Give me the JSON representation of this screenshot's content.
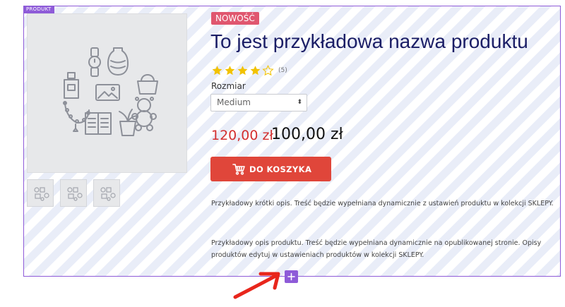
{
  "section": {
    "tag": "PRODUKT"
  },
  "gallery": {
    "main_image_icon": "product-placeholder-icon",
    "thumbnails": [
      "product-thumbnail",
      "product-thumbnail",
      "product-thumbnail"
    ]
  },
  "product": {
    "badge": "NOWOŚĆ",
    "name": "To jest przykładowa nazwa produktu",
    "rating": {
      "value": 4,
      "max": 5,
      "count_label": "(5)"
    },
    "size": {
      "label": "Rozmiar",
      "selected": "Medium"
    },
    "price": {
      "old": "120,00 zł",
      "new": "100,00 zł"
    },
    "cart_button": {
      "label": "DO KOSZYKA",
      "icon": "cart-icon"
    },
    "short_description": "Przykładowy krótki opis. Treść będzie wypełniana dynamicznie z ustawień produktu w kolekcji SKLEPY.",
    "description": "Przykładowy opis produktu. Treść będzie wypełniana dynamicznie na opublikowanej stronie. Opisy produktów edytuj w ustawieniach produktów w kolekcji SKLEPY."
  },
  "editor": {
    "add_section_icon": "plus-icon",
    "pointer": "red-arrow-icon"
  },
  "colors": {
    "accent_purple": "#8e5bd8",
    "badge_pink": "#e0576f",
    "price_red": "#d32f2f",
    "button_red": "#e0463a",
    "title_navy": "#1b1e66",
    "star_gold": "#f2c200"
  }
}
